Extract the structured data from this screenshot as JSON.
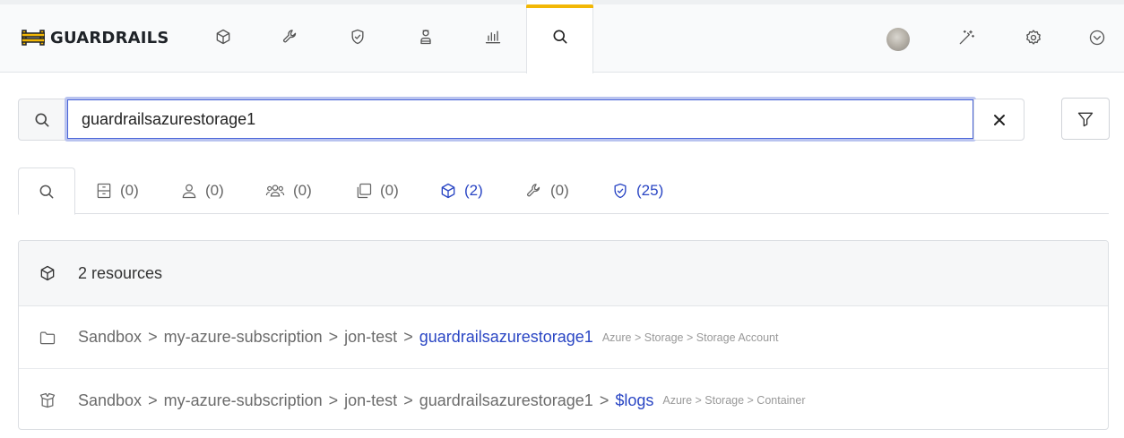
{
  "brand": {
    "name": "GUARDRAILS"
  },
  "nav": {
    "icons": [
      "cube-icon",
      "wrench-icon",
      "shield-check-icon",
      "person-icon",
      "bar-chart-icon",
      "search-icon"
    ],
    "active": "search-icon",
    "right_icons": [
      "avatar",
      "magic-wand-icon",
      "gear-icon",
      "chevron-down-circle-icon"
    ]
  },
  "search": {
    "value": "guardrailsazurestorage1",
    "placeholder": ""
  },
  "tabs": [
    {
      "icon": "search-icon",
      "count": ""
    },
    {
      "icon": "filing-cabinet-icon",
      "count": "(0)"
    },
    {
      "icon": "user-icon",
      "count": "(0)"
    },
    {
      "icon": "users-icon",
      "count": "(0)"
    },
    {
      "icon": "copy-icon",
      "count": "(0)"
    },
    {
      "icon": "cube-icon",
      "count": "(2)"
    },
    {
      "icon": "wrench-icon",
      "count": "(0)"
    },
    {
      "icon": "shield-check-icon",
      "count": "(25)"
    }
  ],
  "results": {
    "header": "2 resources",
    "rows": [
      {
        "icon": "folder-icon",
        "path": [
          "Sandbox",
          "my-azure-subscription",
          "jon-test"
        ],
        "name": "guardrailsazurestorage1",
        "type": "Azure > Storage > Storage Account"
      },
      {
        "icon": "open-box-icon",
        "path": [
          "Sandbox",
          "my-azure-subscription",
          "jon-test",
          "guardrailsazurestorage1"
        ],
        "name": "$logs",
        "type": "Azure > Storage > Container"
      }
    ]
  },
  "colors": {
    "accent": "#2a46c4",
    "active_tab_bar": "#f2b705"
  }
}
